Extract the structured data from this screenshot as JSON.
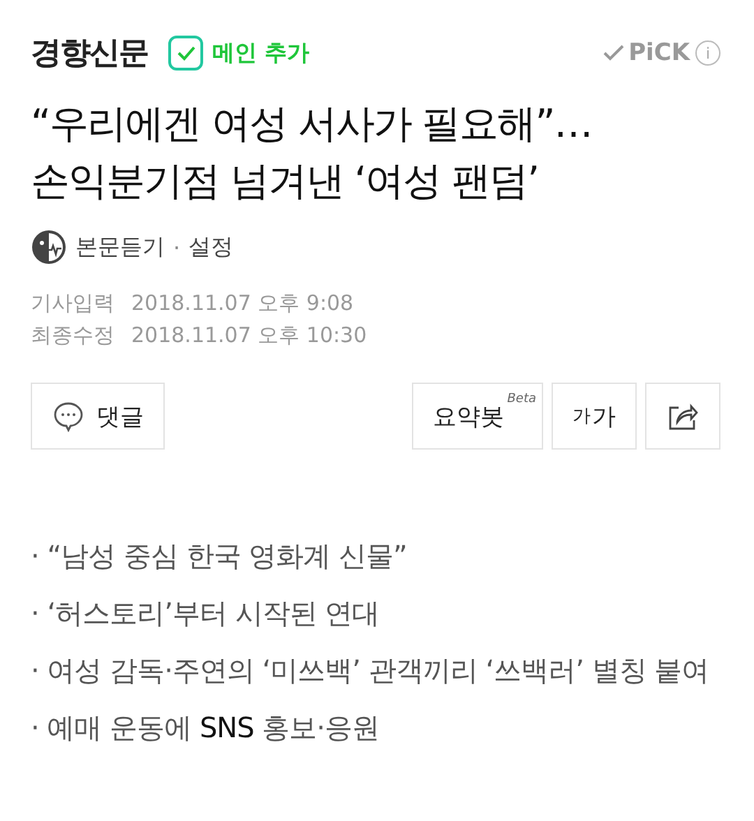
{
  "header": {
    "press": "경향신문",
    "main_add": {
      "label": "메인 추가",
      "checked": true
    },
    "pick": "PiCK",
    "info": "i"
  },
  "headline": [
    "“우리에겐 여성 서사가 필요해”…",
    "손익분기점 넘겨낸 ‘여성 팬덤’"
  ],
  "listen": {
    "label": "본문듣기",
    "separator": "·",
    "settings": "설정"
  },
  "dates": [
    {
      "label": "기사입력",
      "value": "2018.11.07 오후 9:08"
    },
    {
      "label": "최종수정",
      "value": "2018.11.07 오후 10:30"
    }
  ],
  "toolbar": {
    "comment": "댓글",
    "summary": "요약봇",
    "beta": "Beta",
    "font_small": "가",
    "font_large": "가"
  },
  "summary": [
    "· “남성 중심 한국 영화계 신물”",
    "· ‘허스토리’부터 시작된 연대",
    "· 여성 감독·주연의 ‘미쓰백’ 관객끼리 ‘쓰백러’ 별칭 붙여",
    "· 예매 운동에 **SNS** 홍보·응원"
  ]
}
